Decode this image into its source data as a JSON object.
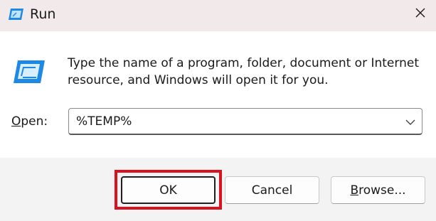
{
  "window": {
    "title": "Run",
    "close_glyph": "✕"
  },
  "icons": {
    "title": "run-app-icon",
    "main": "run-app-icon",
    "close": "close-icon",
    "dropdown": "chevron-down-icon"
  },
  "dialog": {
    "description": "Type the name of a program, folder, document or Internet resource, and Windows will open it for you.",
    "open_label_accel": "O",
    "open_label_rest": "pen:",
    "open_value": "%TEMP%"
  },
  "buttons": {
    "ok": "OK",
    "cancel": "Cancel",
    "browse_accel": "B",
    "browse_rest": "rowse..."
  },
  "colors": {
    "titlebar": "#f2eaea",
    "content": "#ffffff",
    "footer": "#f3f3f3",
    "highlight": "#d8121f",
    "icon_blue": "#1e88e5"
  }
}
